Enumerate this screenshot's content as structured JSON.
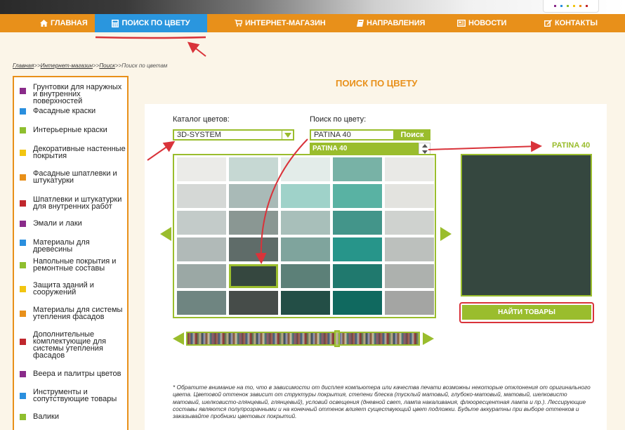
{
  "nav": {
    "items": [
      {
        "label": "ГЛАВНАЯ",
        "icon": "home-icon"
      },
      {
        "label": "ПОИСК ПО ЦВЕТУ",
        "icon": "calculator-icon",
        "active": true
      },
      {
        "label": "ИНТЕРНЕТ-МАГАЗИН",
        "icon": "cart-icon"
      },
      {
        "label": "НАПРАВЛЕНИЯ",
        "icon": "book-icon"
      },
      {
        "label": "НОВОСТИ",
        "icon": "newspaper-icon"
      },
      {
        "label": "КОНТАКТЫ",
        "icon": "edit-icon"
      }
    ]
  },
  "breadcrumb": {
    "items": [
      "Главная",
      "Интернет-магазин",
      "Поиск"
    ],
    "separator": ">>",
    "current": "Поиск по цветам"
  },
  "sidebar": {
    "items": [
      {
        "label": "Грунтовки для наружных и внутренних поверхностей",
        "color": "#8a2b8a"
      },
      {
        "label": "Фасадные краски",
        "color": "#2a8fde"
      },
      {
        "label": "Интерьерные краски",
        "color": "#8fbf2f"
      },
      {
        "label": "Декоративные настенные покрытия",
        "color": "#f2c511"
      },
      {
        "label": "Фасадные шпатлевки и штукатурки",
        "color": "#e8901a"
      },
      {
        "label": "Шпатлевки и штукатурки для внутренних работ",
        "color": "#c0272d"
      },
      {
        "label": "Эмали и лаки",
        "color": "#8a2b8a"
      },
      {
        "label": "Материалы для древесины",
        "color": "#2a8fde"
      },
      {
        "label": "Напольные покрытия и ремонтные составы",
        "color": "#8fbf2f"
      },
      {
        "label": "Защита зданий и сооружений",
        "color": "#f2c511"
      },
      {
        "label": "Материалы для системы утепления фасадов",
        "color": "#e8901a"
      },
      {
        "label": "Дополнительные комплектующие для системы утепления фасадов",
        "color": "#c0272d"
      },
      {
        "label": "Веера и палитры цветов",
        "color": "#8a2b8a"
      },
      {
        "label": "Инструменты и сопутствующие товары",
        "color": "#2a8fde"
      },
      {
        "label": "Валики",
        "color": "#8fbf2f"
      }
    ]
  },
  "main": {
    "title": "ПОИСК ПО ЦВЕТУ",
    "catalog_label": "Каталог цветов:",
    "catalog_value": "3D-SYSTEM",
    "search_label": "Поиск по цвету:",
    "search_value": "PATINA 40",
    "search_button": "Поиск",
    "suggestion": "PATINA 40",
    "preview_name": "PATINA 40",
    "preview_color": "#35473f",
    "find_button": "НАЙТИ ТОВАРЫ",
    "note": "* Обратите внимание на то, что в зависимости от дисплея компьютера или качества печати возможны некоторые отклонения от оригинального цвета. Цветовой оттенок зависит от структуры покрытия, степени блеска (тусклый матовый, глубоко-матовый, матовый, шелковисто матовый, шелковисто-глянцевый, глянцевый), условий освещения (дневной свет, лампа накаливания, флюоресцентная лампа и пр.). Лессирующие составы являются полупрозрачными и на конечный оттенок влияет существующий цвет подложки. Будьте аккуратны при выборе оттенков и заказывайте пробники цветовых покрытий."
  },
  "swatches": [
    [
      "#ebebe8",
      "#c6d8d3",
      "#e3ece9",
      "#78b2a6",
      "#e9e9e6"
    ],
    [
      "#d5d8d6",
      "#a9bab7",
      "#9fd2c9",
      "#59b2a3",
      "#e3e3df"
    ],
    [
      "#c3cbc9",
      "#8a9793",
      "#a8bfba",
      "#43958a",
      "#cfd2cf"
    ],
    [
      "#b1bab8",
      "#5f6c69",
      "#7fa49d",
      "#27958a",
      "#bcc0bd"
    ],
    [
      "#9ba8a5",
      "#35473f",
      "#5c8078",
      "#20796e",
      "#adb1ae"
    ],
    [
      "#6f8581",
      "#464c49",
      "#234e46",
      "#10695f",
      "#a4a5a3"
    ]
  ],
  "selected_swatch": {
    "row": 4,
    "col": 1
  },
  "colors": {
    "accent_orange": "#e8901a",
    "accent_green": "#9abd2d",
    "nav_active": "#2a96de",
    "annotation_red": "#d9333a"
  }
}
